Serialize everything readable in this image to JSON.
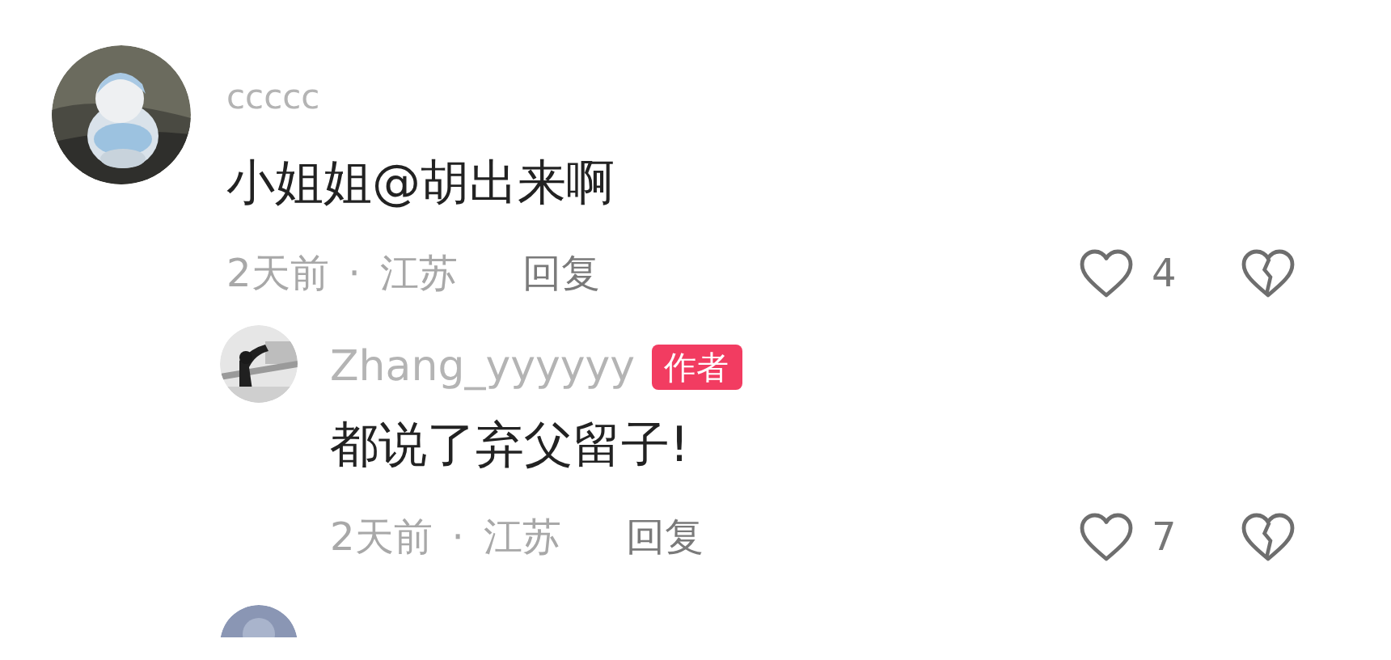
{
  "comments": [
    {
      "username": "ccccc",
      "text": "小姐姐@胡出来啊",
      "time": "2天前",
      "separator": "·",
      "location": "江苏",
      "reply_label": "回复",
      "likes": "4",
      "liked": false,
      "disliked": false,
      "replies": [
        {
          "username": "Zhang_yyyyyy",
          "badge": "作者",
          "text": "都说了弃父留子!",
          "time": "2天前",
          "separator": "·",
          "location": "江苏",
          "reply_label": "回复",
          "likes": "7",
          "liked": false,
          "disliked": false
        }
      ]
    }
  ]
}
